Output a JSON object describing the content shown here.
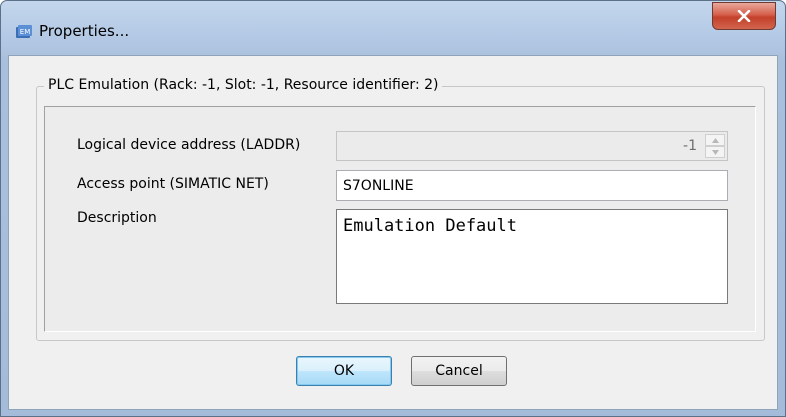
{
  "window": {
    "title": "Properties...",
    "close_icon": "close-x-icon",
    "app_icon": "simatic-emulation-icon"
  },
  "group": {
    "label": "PLC Emulation (Rack: -1, Slot: -1, Resource identifier: 2)"
  },
  "fields": {
    "laddr": {
      "label": "Logical device address (LADDR)",
      "value": "-1",
      "enabled": false
    },
    "access_point": {
      "label": "Access point (SIMATIC NET)",
      "value": "S7ONLINE"
    },
    "description": {
      "label": "Description",
      "value": "Emulation Default"
    }
  },
  "buttons": {
    "ok": "OK",
    "cancel": "Cancel"
  },
  "colors": {
    "title_gradient_top": "#c3d6ec",
    "close_button": "#c3402a",
    "dialog_background": "#f0f0f0",
    "default_button_border": "#3c7fb1"
  }
}
